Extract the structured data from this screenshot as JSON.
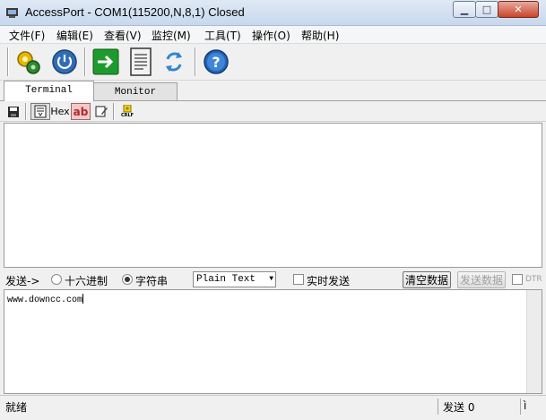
{
  "window": {
    "title": "AccessPort - COM1(115200,N,8,1) Closed",
    "controls": {
      "minimize": "▁",
      "maximize": "□",
      "close": "✕"
    }
  },
  "menu": [
    {
      "label": "文件(F)"
    },
    {
      "label": "编辑(E)"
    },
    {
      "label": "查看(V)"
    },
    {
      "label": "监控(M)"
    },
    {
      "label": "工具(T)"
    },
    {
      "label": "操作(O)"
    },
    {
      "label": "帮助(H)"
    }
  ],
  "toolbar": {
    "buttons": [
      {
        "icon": "settings-gear-icon"
      },
      {
        "icon": "power-icon"
      },
      {
        "icon": "go-arrow-icon"
      },
      {
        "icon": "document-icon"
      },
      {
        "icon": "refresh-icon"
      },
      {
        "icon": "help-icon"
      }
    ]
  },
  "tabs": [
    {
      "label": "Terminal",
      "active": true
    },
    {
      "label": "Monitor",
      "active": false
    }
  ],
  "subtoolbar": {
    "hex_label": "Hex",
    "ab_label": "ab",
    "crlf_label": "CRLF"
  },
  "send": {
    "label": "发送->",
    "radio_hex": "十六进制",
    "radio_string": "字符串",
    "format_value": "Plain Text",
    "realtime_label": "实时发送",
    "clear_button": "清空数据",
    "send_button": "发送数据",
    "dtr_label": "DTR",
    "input_text": "www.downcc.com"
  },
  "status": {
    "left": "就绪",
    "sent": "发送 0"
  },
  "colors": {
    "accent_blue": "#1e63b8",
    "green": "#1f9a2f",
    "ab_red": "#b0282a"
  }
}
